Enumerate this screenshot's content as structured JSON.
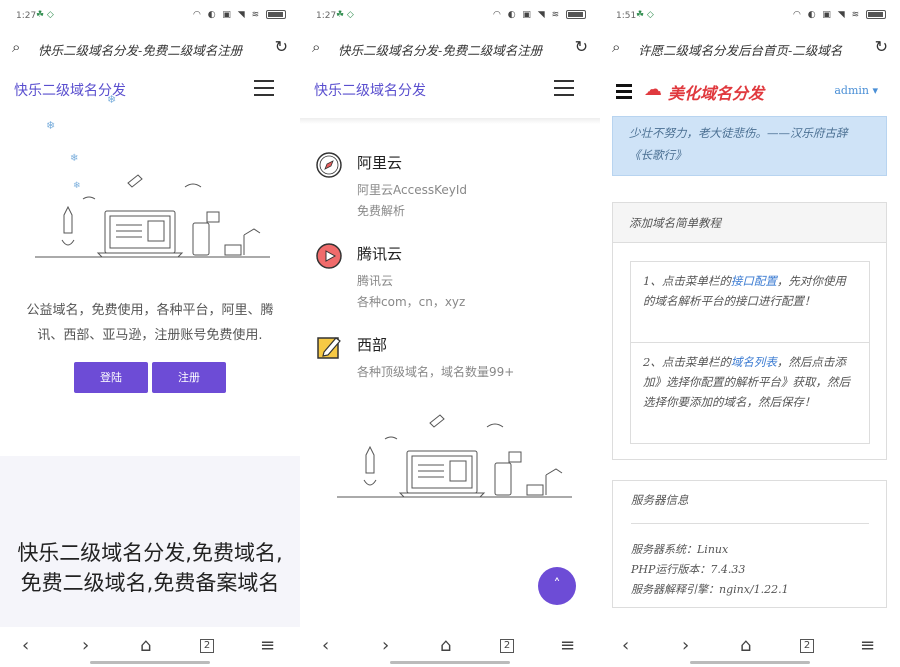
{
  "screens": [
    {
      "status": {
        "time": "1:27",
        "app_icons": "☘ ◇",
        "sys_icons": "◠ ◐ ▣ ◥ ≋"
      },
      "url": "快乐二级域名分发-免费二级域名注册",
      "brand": "快乐二级域名分发",
      "description": "公益域名，免费使用，各种平台，阿里、腾讯、西部、亚马逊，注册账号免费使用.",
      "buttons": {
        "login": "登陆",
        "register": "注册"
      },
      "big_title": "快乐二级域名分发,免费域名,免费二级域名,免费备案域名"
    },
    {
      "status": {
        "time": "1:27",
        "app_icons": "☘ ◇",
        "sys_icons": "◠ ◐ ▣ ◥ ≋"
      },
      "url": "快乐二级域名分发-免费二级域名注册",
      "brand": "快乐二级域名分发",
      "providers": [
        {
          "name": "阿里云",
          "lines": [
            "阿里云AccessKeyId",
            "免费解析"
          ],
          "icon": "compass-icon"
        },
        {
          "name": "腾讯云",
          "lines": [
            "腾讯云",
            "各种com，cn，xyz"
          ],
          "icon": "play-icon"
        },
        {
          "name": "西部",
          "lines": [
            "各种顶级域名，域名数量99+"
          ],
          "icon": "edit-icon"
        }
      ],
      "fab_label": "˄"
    },
    {
      "status": {
        "time": "1:51",
        "app_icons": "☘ ◇",
        "sys_icons": "◠ ◐ ▣ ◥ ≋"
      },
      "url": "许愿二级域名分发后台首页-二级域名",
      "logo": "美化域名分发",
      "admin": "admin ▾",
      "quote": "少壮不努力，老大徒悲伤。——汉乐府古辞《长歌行》",
      "tutorial": {
        "title": "添加域名简单教程",
        "step1": {
          "prefix": "1、点击菜单栏的",
          "link": "接口配置",
          "suffix": "，先对你使用的域名解析平台的接口进行配置！"
        },
        "step2": {
          "prefix": "2、点击菜单栏的",
          "link": "域名列表",
          "suffix": "，然后点击添加》选择你配置的解析平台》获取，然后选择你要添加的域名，然后保存！"
        }
      },
      "server": {
        "title": "服务器信息",
        "system": "服务器系统：Linux",
        "php": "PHP运行版本：7.4.33",
        "engine": "服务器解释引擎：nginx/1.22.1"
      }
    }
  ],
  "nav": {
    "back": "‹",
    "forward": "›",
    "home": "⌂",
    "tabs": "2",
    "menu": "≡"
  },
  "colors": {
    "accent": "#6d4cd6",
    "brand_text": "#5a4fcf",
    "logo_red": "#e0393e",
    "link": "#3b7bd2",
    "quote_bg": "#cfe3f7"
  }
}
